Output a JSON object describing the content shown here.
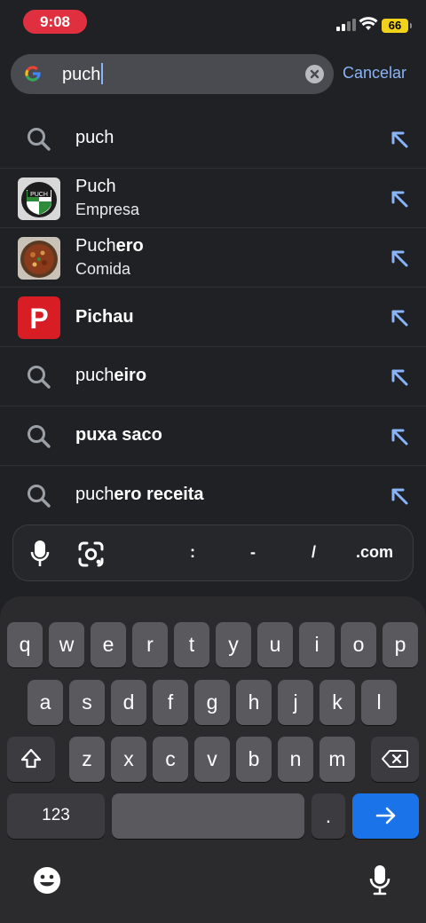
{
  "status_bar": {
    "time": "9:08",
    "battery": "66"
  },
  "search": {
    "value": "puch",
    "cancel_label": "Cancelar"
  },
  "suggestions": [
    {
      "type": "query",
      "pre": "puch",
      "bold": ""
    },
    {
      "type": "entity",
      "title": "Puch",
      "subtitle": "Empresa",
      "thumb": "puch-logo"
    },
    {
      "type": "entity",
      "pre": "Puch",
      "bold": "ero",
      "subtitle": "Comida",
      "thumb": "puchero-dish"
    },
    {
      "type": "entity",
      "bold": "Pichau",
      "thumb": "pichau-logo"
    },
    {
      "type": "query",
      "pre": "puch",
      "bold": "eiro"
    },
    {
      "type": "query",
      "pre": "",
      "bold": "puxa saco"
    },
    {
      "type": "query",
      "pre": "puch",
      "bold": "ero receita"
    }
  ],
  "accessory": {
    "colon": ":",
    "dash": "-",
    "slash": "/",
    "com": ".com"
  },
  "keyboard": {
    "row1": [
      "q",
      "w",
      "e",
      "r",
      "t",
      "y",
      "u",
      "i",
      "o",
      "p"
    ],
    "row2": [
      "a",
      "s",
      "d",
      "f",
      "g",
      "h",
      "j",
      "k",
      "l"
    ],
    "row3": [
      "z",
      "x",
      "c",
      "v",
      "b",
      "n",
      "m"
    ],
    "numbers": "123",
    "period": "."
  },
  "thumb_labels": {
    "puch": "PUCH",
    "pichau": "P"
  },
  "colors": {
    "accent": "#8ab4f8",
    "time_pill": "#e03040",
    "battery": "#f1d21a",
    "go_key": "#1a73e8"
  }
}
